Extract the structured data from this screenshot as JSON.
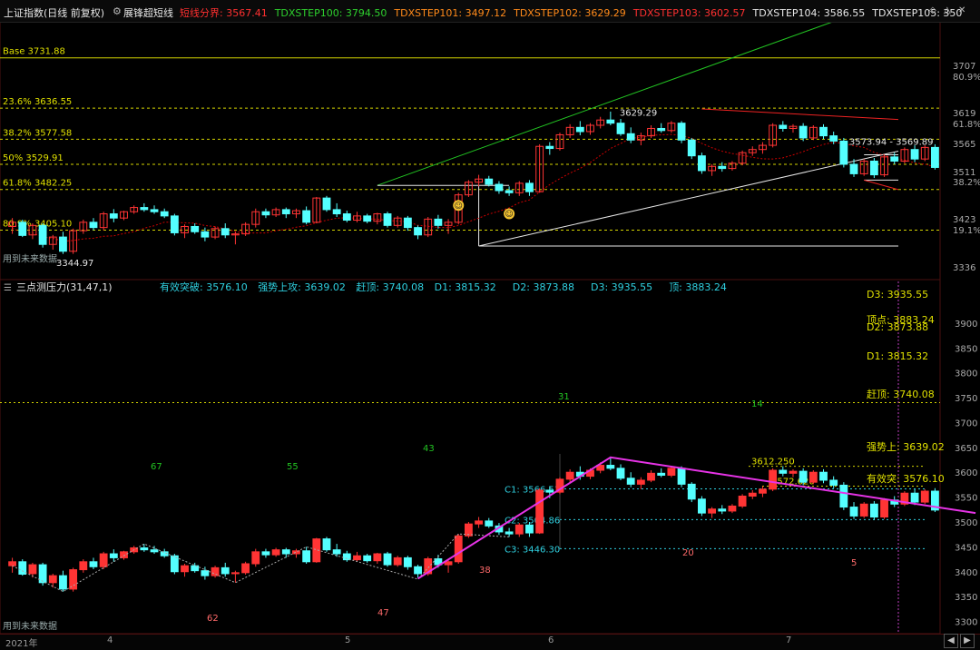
{
  "header": {
    "symbol": "上证指数(日线 前复权)",
    "indicator": "展锋超短线",
    "values": [
      {
        "label": "短线分界",
        "value": "3567.41",
        "color": "#ff3030"
      },
      {
        "label": "TDXSTEP100",
        "value": "3794.50",
        "color": "#2ed12e"
      },
      {
        "label": "TDXSTEP101",
        "value": "3497.12",
        "color": "#ff8a1a"
      },
      {
        "label": "TDXSTEP102",
        "value": "3629.29",
        "color": "#ff8a1a"
      },
      {
        "label": "TDXSTEP103",
        "value": "3602.57",
        "color": "#ff3030"
      },
      {
        "label": "TDXSTEP104",
        "value": "3586.55",
        "color": "#e8e8e8"
      },
      {
        "label": "TDXSTEP105",
        "value": "350",
        "color": "#e8e8e8"
      }
    ]
  },
  "upper": {
    "base_label": "Base 3731.88",
    "fib_labels": [
      "23.6% 3636.55",
      "38.2% 3577.58",
      "50% 3529.91",
      "61.8% 3482.25",
      "80.9% 3405.10"
    ],
    "price_labels": [
      "3629.29",
      "3573.94",
      "3569.89"
    ],
    "low_label": "3344.97",
    "future_label": "用到未来数据",
    "right_axis": [
      "3707",
      "80.9%",
      "3619",
      "61.8%",
      "3565",
      "3511",
      "38.2%",
      "3423",
      "19.1%",
      "3336"
    ],
    "candles": [
      [
        3412,
        3428,
        3398,
        3420
      ],
      [
        3420,
        3425,
        3392,
        3395
      ],
      [
        3396,
        3418,
        3388,
        3414
      ],
      [
        3414,
        3418,
        3372,
        3378
      ],
      [
        3378,
        3396,
        3368,
        3392
      ],
      [
        3392,
        3402,
        3360,
        3365
      ],
      [
        3365,
        3408,
        3360,
        3404
      ],
      [
        3404,
        3425,
        3398,
        3420
      ],
      [
        3420,
        3428,
        3405,
        3410
      ],
      [
        3410,
        3440,
        3405,
        3436
      ],
      [
        3436,
        3445,
        3420,
        3428
      ],
      [
        3428,
        3442,
        3424,
        3440
      ],
      [
        3440,
        3452,
        3436,
        3448
      ],
      [
        3448,
        3456,
        3440,
        3444
      ],
      [
        3444,
        3452,
        3436,
        3440
      ],
      [
        3440,
        3446,
        3428,
        3432
      ],
      [
        3432,
        3436,
        3395,
        3400
      ],
      [
        3400,
        3416,
        3390,
        3412
      ],
      [
        3412,
        3418,
        3398,
        3402
      ],
      [
        3402,
        3410,
        3384,
        3392
      ],
      [
        3392,
        3412,
        3388,
        3408
      ],
      [
        3408,
        3418,
        3390,
        3396
      ],
      [
        3396,
        3402,
        3378,
        3398
      ],
      [
        3398,
        3420,
        3394,
        3416
      ],
      [
        3416,
        3446,
        3410,
        3440
      ],
      [
        3440,
        3446,
        3428,
        3434
      ],
      [
        3434,
        3448,
        3430,
        3444
      ],
      [
        3444,
        3448,
        3428,
        3436
      ],
      [
        3436,
        3446,
        3428,
        3442
      ],
      [
        3442,
        3450,
        3416,
        3420
      ],
      [
        3420,
        3468,
        3418,
        3466
      ],
      [
        3466,
        3470,
        3440,
        3444
      ],
      [
        3444,
        3456,
        3430,
        3436
      ],
      [
        3436,
        3442,
        3420,
        3424
      ],
      [
        3424,
        3440,
        3420,
        3432
      ],
      [
        3432,
        3436,
        3418,
        3422
      ],
      [
        3422,
        3438,
        3416,
        3436
      ],
      [
        3436,
        3440,
        3410,
        3414
      ],
      [
        3414,
        3432,
        3410,
        3428
      ],
      [
        3428,
        3432,
        3404,
        3410
      ],
      [
        3410,
        3414,
        3388,
        3396
      ],
      [
        3396,
        3430,
        3392,
        3426
      ],
      [
        3426,
        3434,
        3408,
        3414
      ],
      [
        3414,
        3426,
        3398,
        3420
      ],
      [
        3420,
        3476,
        3416,
        3472
      ],
      [
        3472,
        3500,
        3468,
        3496
      ],
      [
        3496,
        3510,
        3488,
        3502
      ],
      [
        3502,
        3508,
        3488,
        3492
      ],
      [
        3492,
        3498,
        3474,
        3480
      ],
      [
        3480,
        3488,
        3470,
        3476
      ],
      [
        3476,
        3498,
        3470,
        3494
      ],
      [
        3494,
        3500,
        3470,
        3478
      ],
      [
        3478,
        3568,
        3476,
        3564
      ],
      [
        3564,
        3572,
        3548,
        3560
      ],
      [
        3560,
        3590,
        3556,
        3586
      ],
      [
        3586,
        3606,
        3580,
        3600
      ],
      [
        3600,
        3612,
        3585,
        3592
      ],
      [
        3592,
        3608,
        3586,
        3604
      ],
      [
        3604,
        3620,
        3598,
        3614
      ],
      [
        3614,
        3630,
        3604,
        3608
      ],
      [
        3608,
        3616,
        3584,
        3588
      ],
      [
        3588,
        3600,
        3570,
        3576
      ],
      [
        3576,
        3590,
        3566,
        3584
      ],
      [
        3584,
        3604,
        3580,
        3598
      ],
      [
        3598,
        3608,
        3590,
        3594
      ],
      [
        3594,
        3612,
        3590,
        3608
      ],
      [
        3608,
        3612,
        3570,
        3576
      ],
      [
        3576,
        3580,
        3540,
        3546
      ],
      [
        3546,
        3552,
        3512,
        3518
      ],
      [
        3518,
        3530,
        3508,
        3526
      ],
      [
        3526,
        3534,
        3516,
        3522
      ],
      [
        3522,
        3536,
        3518,
        3532
      ],
      [
        3532,
        3556,
        3528,
        3552
      ],
      [
        3552,
        3564,
        3546,
        3558
      ],
      [
        3558,
        3572,
        3550,
        3566
      ],
      [
        3566,
        3608,
        3562,
        3604
      ],
      [
        3604,
        3612,
        3592,
        3598
      ],
      [
        3598,
        3606,
        3590,
        3602
      ],
      [
        3602,
        3608,
        3574,
        3580
      ],
      [
        3580,
        3604,
        3576,
        3600
      ],
      [
        3600,
        3606,
        3578,
        3584
      ],
      [
        3584,
        3592,
        3568,
        3574
      ],
      [
        3574,
        3580,
        3524,
        3530
      ],
      [
        3530,
        3540,
        3506,
        3512
      ],
      [
        3512,
        3540,
        3508,
        3536
      ],
      [
        3536,
        3542,
        3504,
        3510
      ],
      [
        3510,
        3548,
        3506,
        3544
      ],
      [
        3544,
        3552,
        3530,
        3536
      ],
      [
        3536,
        3562,
        3532,
        3558
      ],
      [
        3558,
        3566,
        3534,
        3540
      ],
      [
        3540,
        3566,
        3536,
        3562
      ],
      [
        3562,
        3568,
        3520,
        3524
      ]
    ],
    "fib_levels": [
      3731.88,
      3636.55,
      3577.58,
      3529.91,
      3482.25,
      3405.1
    ],
    "y_range": [
      3325,
      3790
    ]
  },
  "lower": {
    "title": "三点测压力(31,47,1)",
    "values": [
      {
        "label": "有效突破",
        "value": "3576.10"
      },
      {
        "label": "强势上攻",
        "value": "3639.02"
      },
      {
        "label": "赶顶",
        "value": "3740.08"
      },
      {
        "label": "D1",
        "value": "3815.32"
      },
      {
        "label": "D2",
        "value": "3873.88"
      },
      {
        "label": "D3",
        "value": "3935.55"
      },
      {
        "label": "顶",
        "value": "3883.24"
      }
    ],
    "right_labels": [
      "D3: 3935.55",
      "顶点: 3883.24",
      "D2: 3873.88",
      "D1: 3815.32",
      "赶顶: 3740.08",
      "强势上: 3639.02",
      "有效突: 3576.10"
    ],
    "c_labels": [
      "C1: 3566.53",
      "C2: 3504.86",
      "C3: 3446.30"
    ],
    "box_labels": [
      "3612.250",
      "3572.620"
    ],
    "wave_numbers": [
      "67",
      "55",
      "43",
      "31",
      "14",
      "62",
      "47",
      "38",
      "20",
      "5"
    ],
    "future_label": "用到未来数据",
    "right_axis": [
      "3900",
      "3850",
      "3800",
      "3750",
      "3700",
      "3650",
      "3600",
      "3550",
      "3500",
      "3450",
      "3400",
      "3350",
      "3300"
    ],
    "y_range": [
      3290,
      3940
    ]
  },
  "axis": {
    "dates": [
      "2021年",
      "4",
      "5",
      "6",
      "7"
    ]
  },
  "colors": {
    "up": "#ff3434",
    "down": "#54ffff",
    "bg": "#000000",
    "fib": "#ffff00"
  }
}
